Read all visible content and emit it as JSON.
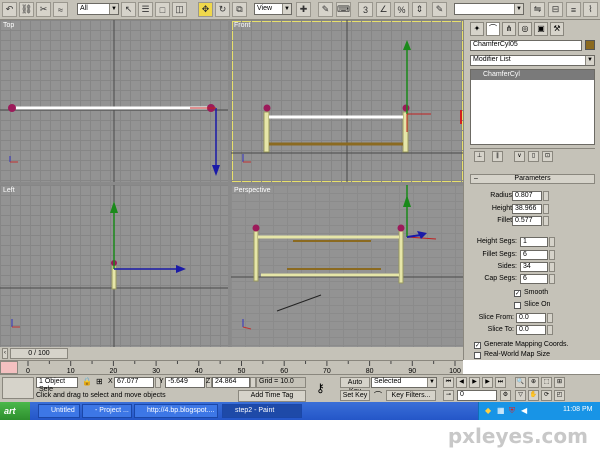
{
  "toolbar": {
    "selection_filter": "All",
    "reference_coord": "View",
    "named_selection": ""
  },
  "viewports": {
    "top": "Top",
    "front": "Front",
    "left": "Left",
    "perspective": "Perspective"
  },
  "command_panel": {
    "object_name": "ChamferCyl05",
    "modifier_list": "Modifier List",
    "stack_item": "ChamferCyl",
    "rollout_title": "Parameters",
    "rollout_toggle": "–",
    "params": {
      "radius_label": "Radius:",
      "radius": "0.807",
      "height_label": "Height:",
      "height": "38.966",
      "fillet_label": "Fillet:",
      "fillet": "0.577",
      "height_segs_label": "Height Segs:",
      "height_segs": "1",
      "fillet_segs_label": "Fillet Segs:",
      "fillet_segs": "6",
      "sides_label": "Sides:",
      "sides": "34",
      "cap_segs_label": "Cap Segs:",
      "cap_segs": "6",
      "smooth_label": "Smooth",
      "slice_on_label": "Slice On",
      "slice_from_label": "Slice From:",
      "slice_from": "0.0",
      "slice_to_label": "Slice To:",
      "slice_to": "0.0",
      "gen_mapping_label": "Generate Mapping Coords.",
      "real_world_label": "Real-World Map Size"
    }
  },
  "timeline": {
    "frame": "0 / 100"
  },
  "ruler": {
    "ticks": [
      "0",
      "10",
      "20",
      "30",
      "40",
      "50",
      "60",
      "70",
      "80",
      "90",
      "100"
    ]
  },
  "status": {
    "selection": "1 Object Sele",
    "x_label": "X",
    "x": "67.077",
    "y_label": "Y",
    "y": "-5.649",
    "z_label": "Z",
    "z": "24.864",
    "grid": "Grid = 10.0",
    "prompt": "Click and drag to select and move objects",
    "add_time_tag": "Add Time Tag",
    "auto_key": "Auto Key",
    "key_mode": "Selected",
    "set_key": "Set Key",
    "key_filters": "Key Filters...",
    "current_frame": "0"
  },
  "taskbar": {
    "start": "art",
    "tasks": [
      "Untitled",
      "- Project ...",
      "http://4.bp.blogspot....",
      "step2 - Paint"
    ],
    "clock": "11:08 PM"
  },
  "watermark": "pxleyes.com",
  "colors": {
    "viewport_bg": "#939393",
    "active_border": "#e8e06a",
    "ui_gray": "#c5c2b8",
    "taskbar_blue": "#2456c8",
    "object_cream": "#e6e6a8",
    "object_brown": "#8b6a20",
    "selection_white": "#ffffff",
    "magenta": "#9c1a5a"
  }
}
